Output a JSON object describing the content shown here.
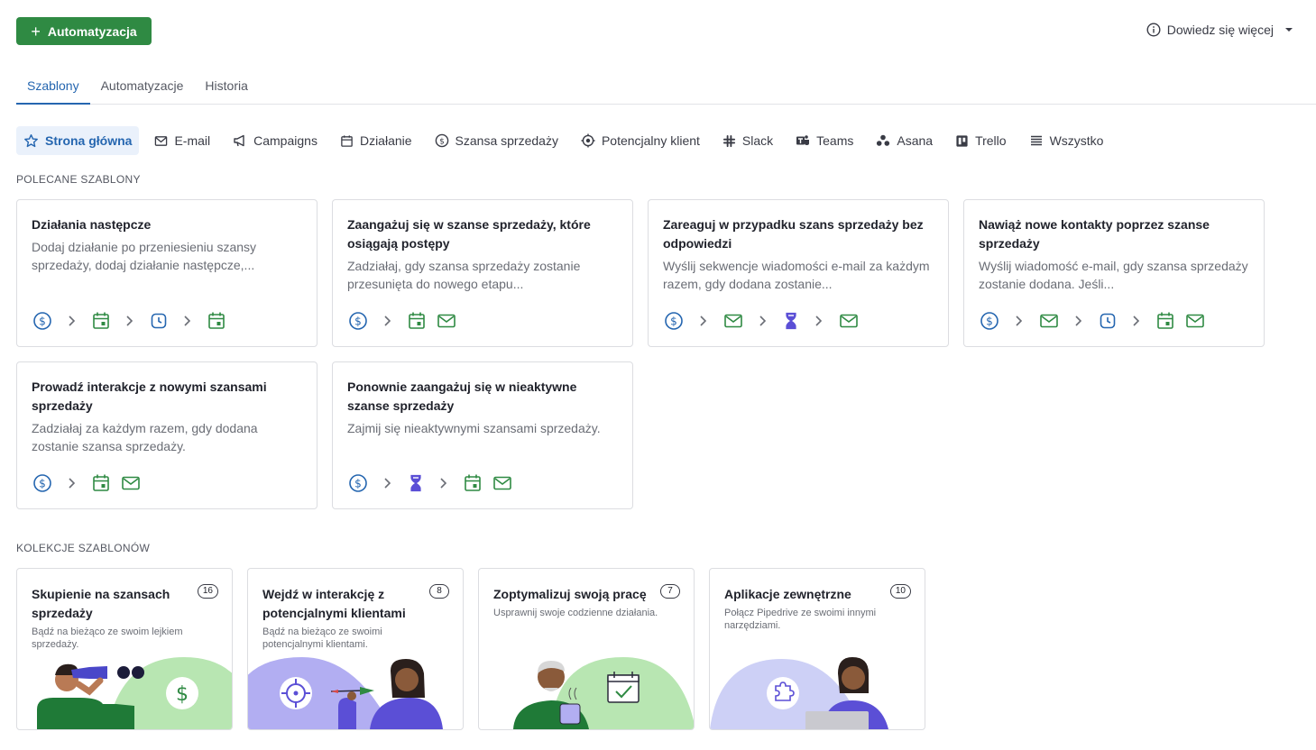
{
  "toolbar": {
    "primary_button": "Automatyzacja",
    "learn_more": "Dowiedz się więcej"
  },
  "tabs": [
    {
      "label": "Szablony",
      "active": true
    },
    {
      "label": "Automatyzacje",
      "active": false
    },
    {
      "label": "Historia",
      "active": false
    }
  ],
  "filters": [
    {
      "label": "Strona główna",
      "icon": "star-icon",
      "active": true
    },
    {
      "label": "E-mail",
      "icon": "mail-icon"
    },
    {
      "label": "Campaigns",
      "icon": "megaphone-icon"
    },
    {
      "label": "Działanie",
      "icon": "calendar-icon"
    },
    {
      "label": "Szansa sprzedaży",
      "icon": "dollar-icon"
    },
    {
      "label": "Potencjalny klient",
      "icon": "target-icon"
    },
    {
      "label": "Slack",
      "icon": "slack-icon"
    },
    {
      "label": "Teams",
      "icon": "teams-icon"
    },
    {
      "label": "Asana",
      "icon": "asana-icon"
    },
    {
      "label": "Trello",
      "icon": "trello-icon"
    },
    {
      "label": "Wszystko",
      "icon": "list-icon"
    }
  ],
  "featured": {
    "label": "POLECANE SZABLONY",
    "cards": [
      {
        "title": "Działania następcze",
        "desc": "Dodaj działanie po przeniesieniu szansy sprzedaży, dodaj działanie następcze,...",
        "icons": [
          "dollar",
          "chevron",
          "calendar",
          "chevron",
          "clock",
          "chevron",
          "calendar"
        ]
      },
      {
        "title": "Zaangażuj się w szanse sprzedaży, które osiągają postępy",
        "desc": "Zadziałaj, gdy szansa sprzedaży zostanie przesunięta do nowego etapu...",
        "icons": [
          "dollar",
          "chevron",
          "calendar",
          "mail"
        ]
      },
      {
        "title": "Zareaguj w przypadku szans sprzedaży bez odpowiedzi",
        "desc": "Wyślij sekwencje wiadomości e-mail za każdym razem, gdy dodana zostanie...",
        "icons": [
          "dollar",
          "chevron",
          "mail",
          "chevron",
          "hourglass",
          "chevron",
          "mail"
        ]
      },
      {
        "title": "Nawiąż nowe kontakty poprzez szanse sprzedaży",
        "desc": "Wyślij wiadomość e-mail, gdy szansa sprzedaży zostanie dodana. Jeśli...",
        "icons": [
          "dollar",
          "chevron",
          "mail",
          "chevron",
          "clock",
          "chevron",
          "calendar",
          "mail"
        ]
      },
      {
        "title": "Prowadź interakcje z nowymi szansami sprzedaży",
        "desc": "Zadziałaj za każdym razem, gdy dodana zostanie szansa sprzedaży.",
        "icons": [
          "dollar",
          "chevron",
          "calendar",
          "mail"
        ]
      },
      {
        "title": "Ponownie zaangażuj się w nieaktywne szanse sprzedaży",
        "desc": "Zajmij się nieaktywnymi szansami sprzedaży.",
        "icons": [
          "dollar",
          "chevron",
          "hourglass",
          "chevron",
          "calendar",
          "mail"
        ]
      }
    ]
  },
  "collections": {
    "label": "KOLEKCJE SZABLONÓW",
    "items": [
      {
        "title": "Skupienie na szansach sprzedaży",
        "count": "16",
        "desc": "Bądź na bieżąco ze swoim lejkiem sprzedaży.",
        "illustration": "binoculars-person"
      },
      {
        "title": "Wejdź w interakcję z potencjalnymi klientami",
        "count": "8",
        "desc": "Bądź na bieżąco ze swoimi potencjalnymi klientami.",
        "illustration": "target-dart-person"
      },
      {
        "title": "Zoptymalizuj swoją pracę",
        "count": "7",
        "desc": "Usprawnij swoje codzienne działania.",
        "illustration": "coffee-calendar-person"
      },
      {
        "title": "Aplikacje zewnętrzne",
        "count": "10",
        "desc": "Połącz Pipedrive ze swoimi innymi narzędziami.",
        "illustration": "puzzle-laptop-person"
      }
    ]
  },
  "colors": {
    "accent": "#2566b0",
    "primary_green": "#2f8a43",
    "hourglass": "#5b4fd6"
  }
}
